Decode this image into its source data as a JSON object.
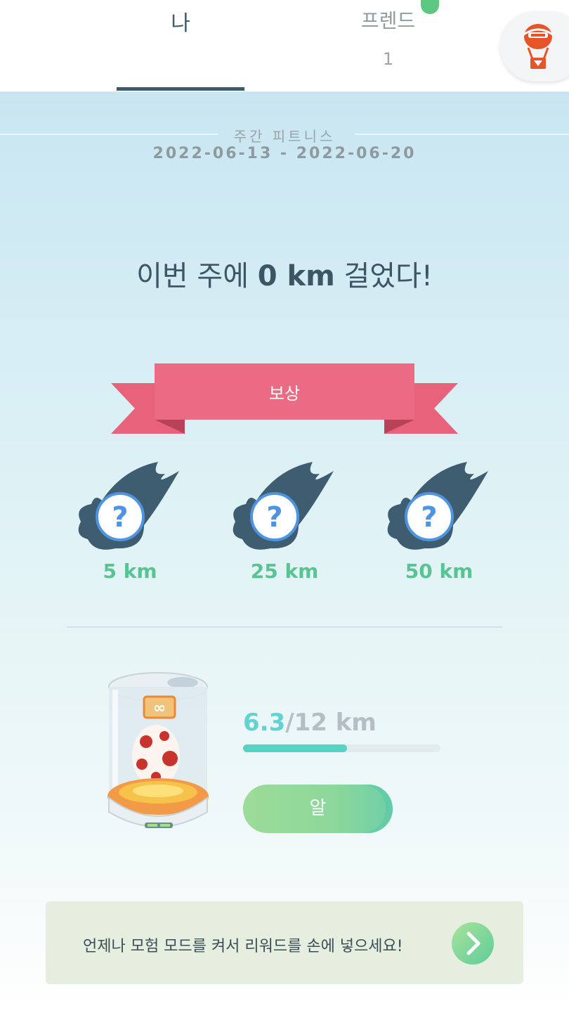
{
  "tabs": {
    "me": {
      "label": "나"
    },
    "friends": {
      "label": "프렌드",
      "count": "1"
    }
  },
  "header": {
    "icon": "balloon-icon",
    "accent": "#e8542a"
  },
  "weekly_fitness": {
    "title": "주간 피트니스",
    "date_range": "2022-06-13 - 2022-06-20"
  },
  "headline": {
    "prefix": "이번 주에 ",
    "distance": "0 km",
    "suffix": " 걸었다!"
  },
  "rewards": {
    "ribbon_label": "보상",
    "items": [
      {
        "icon": "mystery-reward-icon",
        "km": "5 km"
      },
      {
        "icon": "mystery-reward-icon",
        "km": "25 km"
      },
      {
        "icon": "mystery-reward-icon",
        "km": "50 km"
      }
    ]
  },
  "incubator": {
    "icon": "egg-incubator-icon",
    "current_km": "6.3",
    "total_km": "/12 km",
    "progress_fraction": 0.525,
    "button_label": "알"
  },
  "adventure_banner": {
    "text": "언제나 모험 모드를 켜서 리워드를 손에 넣으세요!",
    "icon": "chevron-right-icon"
  },
  "colors": {
    "tab_active": "#3b5c6d",
    "ribbon": "#ec6b84",
    "km_green": "#5ac394",
    "progress_fill": "#57d3c3"
  }
}
